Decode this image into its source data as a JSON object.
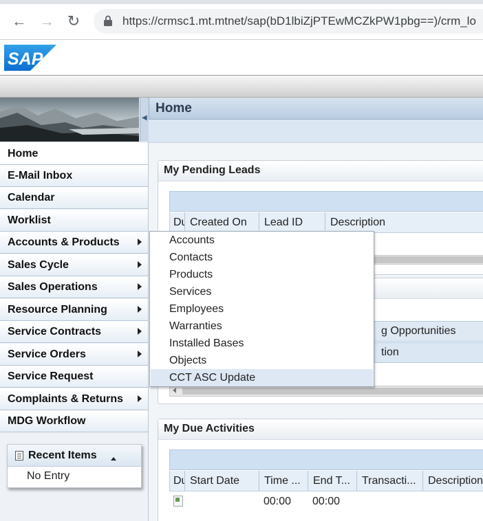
{
  "browser": {
    "url": "https://crmsc1.mt.mtnet/sap(bD1lbiZjPTEwMCZkPW1pbg==)/crm_lo",
    "back_icon": "arrow-left-icon",
    "forward_icon": "arrow-right-icon",
    "reload_icon": "reload-icon",
    "lock_icon": "lock-icon"
  },
  "header": {
    "logo_text": "SAP",
    "logo_color": "#0a6ed1"
  },
  "nav": {
    "items": [
      {
        "label": "Home",
        "has_submenu": false
      },
      {
        "label": "E-Mail Inbox",
        "has_submenu": false
      },
      {
        "label": "Calendar",
        "has_submenu": false
      },
      {
        "label": "Worklist",
        "has_submenu": false
      },
      {
        "label": "Accounts & Products",
        "has_submenu": true
      },
      {
        "label": "Sales Cycle",
        "has_submenu": true
      },
      {
        "label": "Sales Operations",
        "has_submenu": true
      },
      {
        "label": "Resource Planning",
        "has_submenu": true
      },
      {
        "label": "Service Contracts",
        "has_submenu": true
      },
      {
        "label": "Service Orders",
        "has_submenu": true
      },
      {
        "label": "Service Request",
        "has_submenu": false
      },
      {
        "label": "Complaints & Returns",
        "has_submenu": true
      },
      {
        "label": "MDG Workflow",
        "has_submenu": false
      }
    ],
    "recent": {
      "title": "Recent Items",
      "empty_text": "No Entry"
    }
  },
  "main": {
    "title": "Home",
    "pending_leads": {
      "title": "My Pending Leads",
      "columns": [
        "Du",
        "Created On",
        "Lead ID",
        "Description"
      ]
    },
    "opportunities": {
      "visible_text_1": "g Opportunities",
      "visible_text_2": "tion"
    },
    "due_activities": {
      "title": "My Due Activities",
      "columns": [
        "Du",
        "Start Date",
        "Time ...",
        "End T...",
        "Transacti...",
        "Description"
      ],
      "rows": [
        {
          "start_time": "00:00",
          "end_time": "00:00"
        }
      ]
    }
  },
  "menu": {
    "items": [
      "Accounts",
      "Contacts",
      "Products",
      "Services",
      "Employees",
      "Warranties",
      "Installed Bases",
      "Objects",
      "CCT ASC Update"
    ],
    "highlighted_index": 8
  }
}
